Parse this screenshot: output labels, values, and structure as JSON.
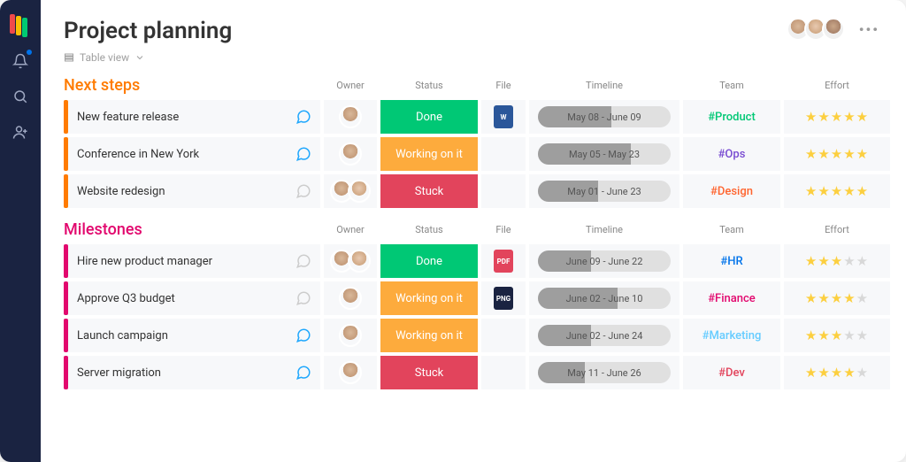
{
  "page_title": "Project planning",
  "view_label": "Table view",
  "columns": {
    "owner": "Owner",
    "status": "Status",
    "file": "File",
    "timeline": "Timeline",
    "team": "Team",
    "effort": "Effort"
  },
  "status_labels": {
    "done": "Done",
    "working": "Working on it",
    "stuck": "Stuck"
  },
  "status_colors": {
    "done": "#00c875",
    "working": "#fdab3d",
    "stuck": "#e2445c"
  },
  "groups": [
    {
      "id": "next-steps",
      "title": "Next steps",
      "color": "#ff7b00",
      "rows": [
        {
          "name": "New feature release",
          "chat_active": true,
          "owners": 1,
          "status": "done",
          "file": {
            "type": "W",
            "color": "#2b579a"
          },
          "timeline": "May 08 - June 09",
          "timeline_fill": 0.55,
          "team": "#Product",
          "team_color": "#00c875",
          "effort": 5
        },
        {
          "name": "Conference in New York",
          "chat_active": true,
          "owners": 1,
          "status": "working",
          "file": null,
          "timeline": "May 05 - May 23",
          "timeline_fill": 0.7,
          "team": "#Ops",
          "team_color": "#784bd1",
          "effort": 5
        },
        {
          "name": "Website redesign",
          "chat_active": false,
          "owners": 2,
          "status": "stuck",
          "file": null,
          "timeline": "May 01 - June 23",
          "timeline_fill": 0.45,
          "team": "#Design",
          "team_color": "#ff642e",
          "effort": 5
        }
      ]
    },
    {
      "id": "milestones",
      "title": "Milestones",
      "color": "#e2086e",
      "rows": [
        {
          "name": "Hire new product manager",
          "chat_active": false,
          "owners": 2,
          "status": "done",
          "file": {
            "type": "PDF",
            "color": "#e2445c"
          },
          "timeline": "June 09 - June 22",
          "timeline_fill": 0.4,
          "team": "#HR",
          "team_color": "#0073ea",
          "effort": 3
        },
        {
          "name": "Approve Q3 budget",
          "chat_active": false,
          "owners": 1,
          "status": "working",
          "file": {
            "type": "PNG",
            "color": "#1a2341"
          },
          "timeline": "June 02 - June 10",
          "timeline_fill": 0.6,
          "team": "#Finance",
          "team_color": "#e2086e",
          "effort": 4
        },
        {
          "name": "Launch campaign",
          "chat_active": true,
          "owners": 1,
          "status": "working",
          "file": null,
          "timeline": "June 02 - June 24",
          "timeline_fill": 0.4,
          "team": "#Marketing",
          "team_color": "#66ccff",
          "effort": 3
        },
        {
          "name": "Server migration",
          "chat_active": true,
          "owners": 1,
          "status": "stuck",
          "file": null,
          "timeline": "May 11 - June 26",
          "timeline_fill": 0.35,
          "team": "#Dev",
          "team_color": "#e2445c",
          "effort": 4
        }
      ]
    }
  ]
}
